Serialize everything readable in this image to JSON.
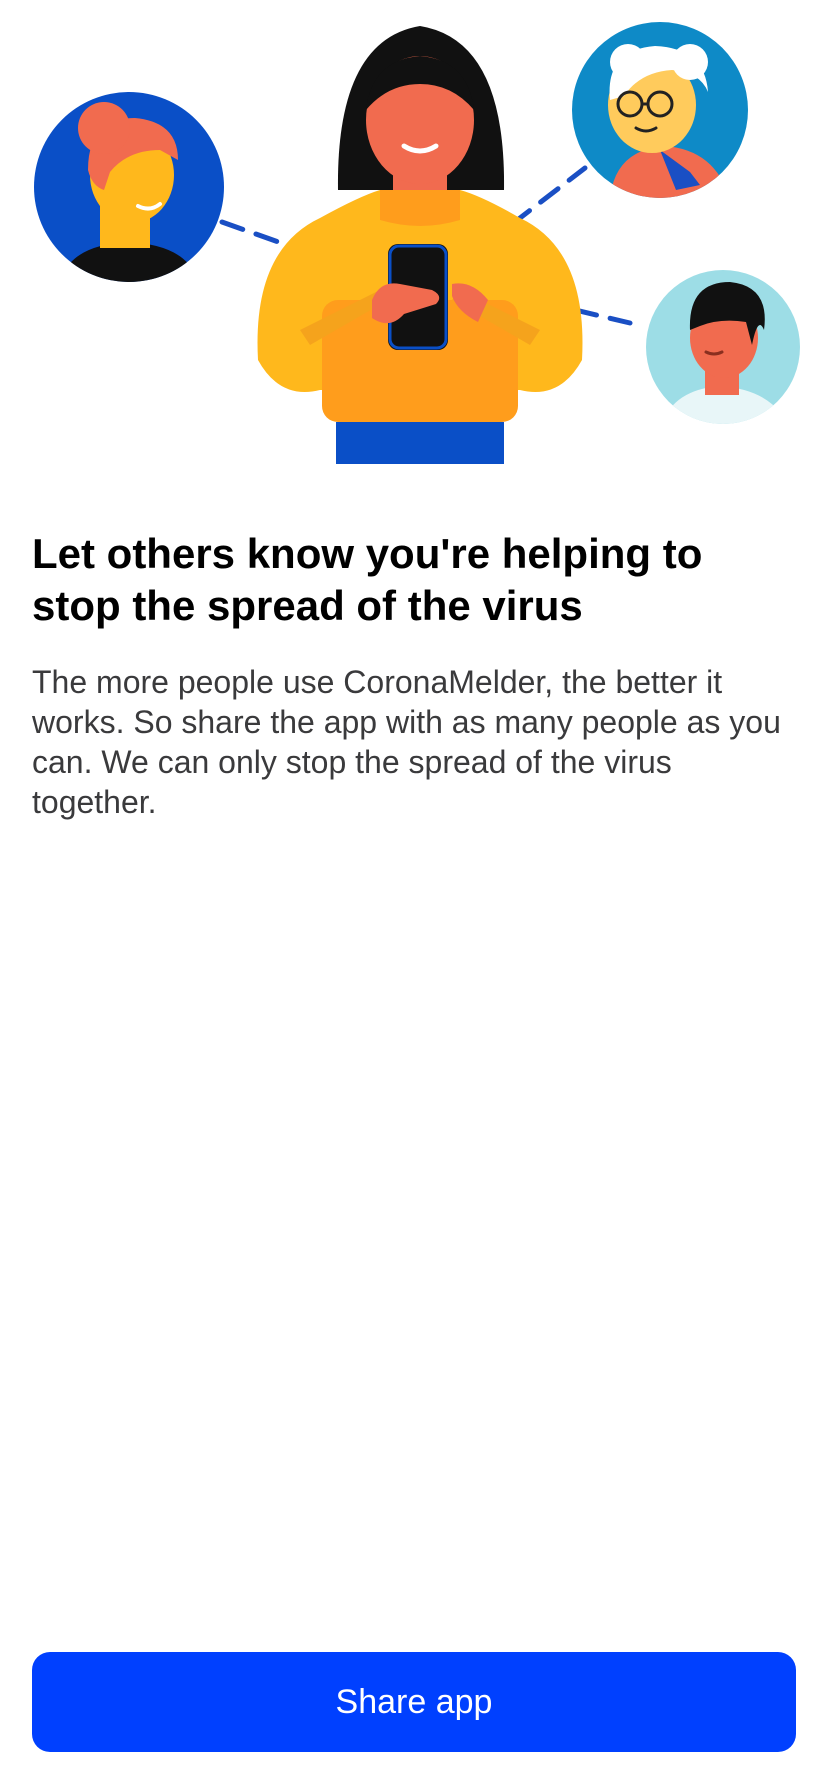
{
  "colors": {
    "background": "#ffffff",
    "accent": "#0040ff",
    "title": "#000000",
    "body_text": "#3a3a3c",
    "illustration_yellow": "#ffb81c",
    "illustration_blue": "#0a4fc7",
    "illustration_skin": "#f16b4f"
  },
  "illustration": {
    "icons": [
      "woman-with-phone-icon",
      "person-avatar-icon",
      "grandmother-avatar-icon",
      "man-avatar-icon",
      "connection-line-icon"
    ]
  },
  "title": "Let others know you're helping to stop the spread of the virus",
  "body": "The more people use CoronaMelder, the better it works. So share the app with as many people as you can. We can only stop the spread of the virus together.",
  "share_button": {
    "label": "Share app"
  }
}
